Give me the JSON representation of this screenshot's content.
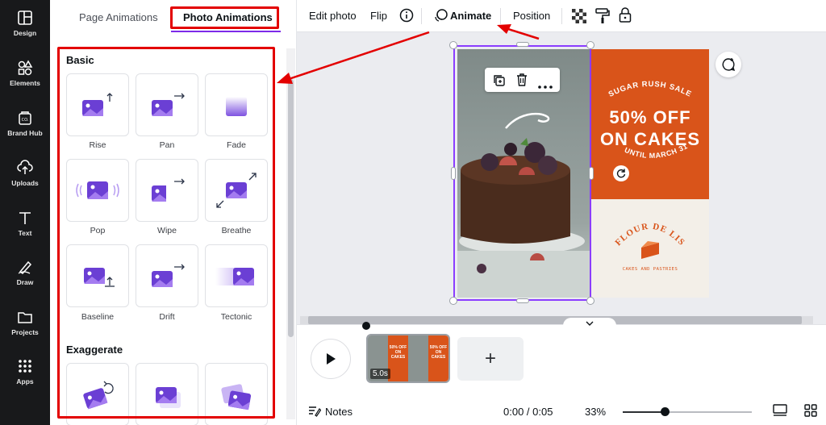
{
  "rail": {
    "items": [
      {
        "label": "Design",
        "icon": "design-icon"
      },
      {
        "label": "Elements",
        "icon": "elements-icon"
      },
      {
        "label": "Brand Hub",
        "icon": "brand-hub-icon"
      },
      {
        "label": "Uploads",
        "icon": "uploads-icon"
      },
      {
        "label": "Text",
        "icon": "text-icon"
      },
      {
        "label": "Draw",
        "icon": "draw-icon"
      },
      {
        "label": "Projects",
        "icon": "projects-icon"
      },
      {
        "label": "Apps",
        "icon": "apps-icon"
      }
    ]
  },
  "panel": {
    "tabs": [
      "Page Animations",
      "Photo Animations"
    ],
    "active_tab": "Photo Animations",
    "basic_title": "Basic",
    "basic": [
      "Rise",
      "Pan",
      "Fade",
      "Pop",
      "Wipe",
      "Breathe",
      "Baseline",
      "Drift",
      "Tectonic"
    ],
    "exaggerate_title": "Exaggerate"
  },
  "toolbar": {
    "edit_photo": "Edit photo",
    "flip": "Flip",
    "animate": "Animate",
    "position": "Position"
  },
  "design": {
    "headline_small": "SUGAR RUSH SALE",
    "headline_line1": "50% OFF",
    "headline_line2": "ON CAKES",
    "date_text": "UNTIL MARCH 31",
    "brand": "FLOUR DE LIS",
    "brand_sub": "CAKES AND PASTRIES"
  },
  "timeline": {
    "clip_duration": "5.0s",
    "notes": "Notes",
    "time": "0:00 / 0:05",
    "zoom": "33%",
    "zoom_level": 0.33,
    "clip_mini_text": "50% OFF ON CAKES"
  },
  "colors": {
    "accent": "#7d2ae8",
    "highlight": "#e30000",
    "orange": "#d9541a",
    "rail_bg": "#18191b"
  }
}
